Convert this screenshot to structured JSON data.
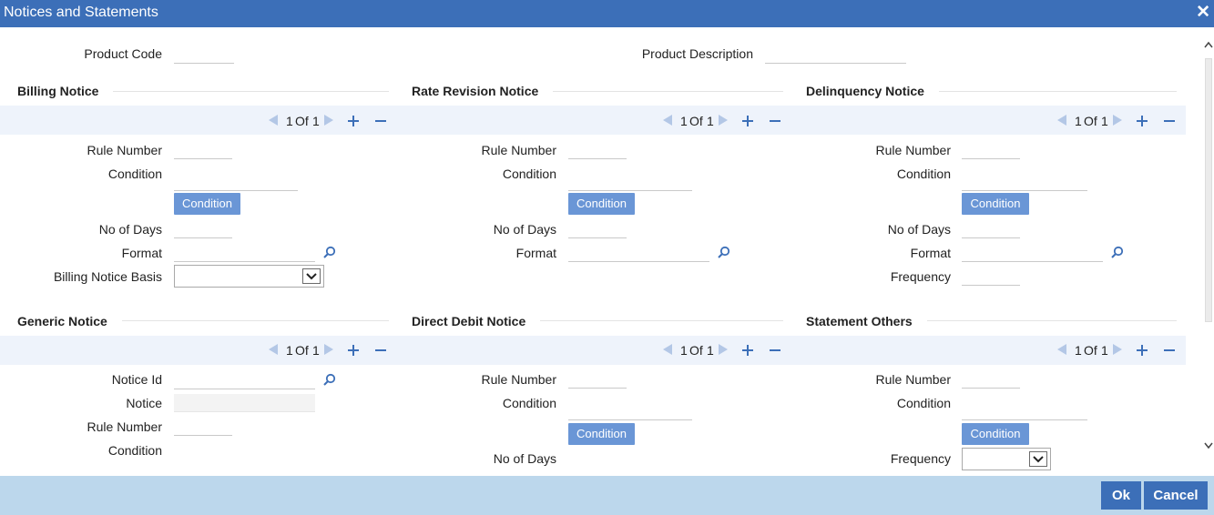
{
  "window": {
    "title": "Notices and Statements"
  },
  "header": {
    "product_code_label": "Product Code",
    "product_code_value": "",
    "product_description_label": "Product Description",
    "product_description_value": ""
  },
  "pagination": {
    "current": "1",
    "of_label": "Of",
    "total": "1"
  },
  "billing": {
    "title": "Billing Notice",
    "rule_number_label": "Rule Number",
    "condition_label": "Condition",
    "condition_button": "Condition",
    "no_of_days_label": "No of Days",
    "format_label": "Format",
    "basis_label": "Billing Notice Basis",
    "basis_selected": ""
  },
  "rate_revision": {
    "title": "Rate Revision Notice",
    "rule_number_label": "Rule Number",
    "condition_label": "Condition",
    "condition_button": "Condition",
    "no_of_days_label": "No of Days",
    "format_label": "Format"
  },
  "delinquency": {
    "title": "Delinquency Notice",
    "rule_number_label": "Rule Number",
    "condition_label": "Condition",
    "condition_button": "Condition",
    "no_of_days_label": "No of Days",
    "format_label": "Format",
    "frequency_label": "Frequency"
  },
  "generic": {
    "title": "Generic Notice",
    "notice_id_label": "Notice Id",
    "notice_label": "Notice",
    "rule_number_label": "Rule Number",
    "condition_label": "Condition"
  },
  "direct_debit": {
    "title": "Direct Debit Notice",
    "rule_number_label": "Rule Number",
    "condition_label": "Condition",
    "condition_button": "Condition",
    "no_of_days_label": "No of Days"
  },
  "statement_others": {
    "title": "Statement Others",
    "rule_number_label": "Rule Number",
    "condition_label": "Condition",
    "condition_button": "Condition",
    "frequency_label": "Frequency",
    "frequency_selected": ""
  },
  "footer": {
    "ok_label": "Ok",
    "cancel_label": "Cancel"
  },
  "colors": {
    "titlebar": "#3c6fb8",
    "condition_button": "#6a96d6",
    "footer": "#bcd7ec",
    "pager_band": "#eef3fb",
    "icon": "#3c6fb8"
  }
}
